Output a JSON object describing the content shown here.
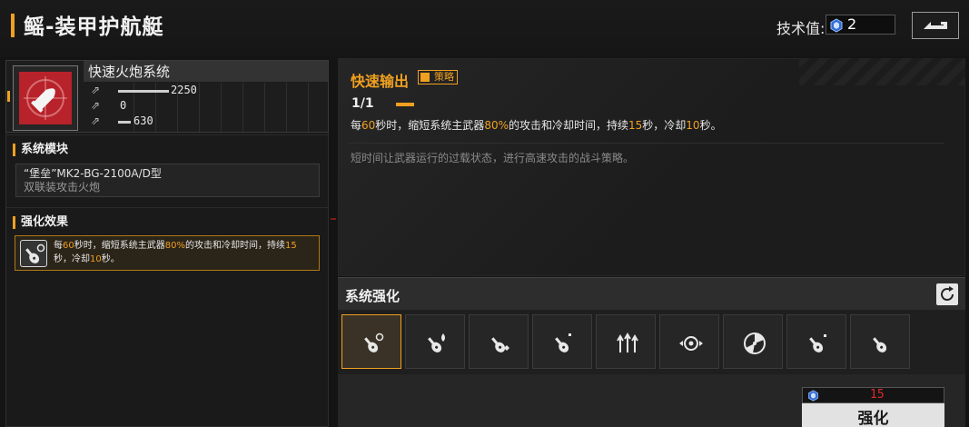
{
  "header": {
    "title": "鳐-装甲护航艇",
    "tech_label": "技术值:",
    "tech_value": "2",
    "back_icon": "return-arrow-icon"
  },
  "module": {
    "name": "快速火炮系统",
    "icon": "cannon-shell-icon",
    "stats": [
      {
        "icon": "arrow-up-icon",
        "value": "2250",
        "fill": 0.78
      },
      {
        "icon": "arrow-up-icon",
        "value": "0",
        "fill": 0.0
      },
      {
        "icon": "arrow-up-icon",
        "value": "630",
        "fill": 0.22
      }
    ]
  },
  "system_module": {
    "label": "系统模块",
    "name": "“堡垒”MK2-BG-2100A/D型",
    "type": "双联装攻击火炮"
  },
  "enhance_effect": {
    "label": "强化效果",
    "parts": [
      "每",
      "60",
      "秒时，缩短系统主武器",
      "80%",
      "的攻击和冷却时间，持续",
      "15",
      "秒，冷却",
      "10",
      "秒。"
    ]
  },
  "skill": {
    "title": "快速输出",
    "tag": "策略",
    "level": "1/1",
    "desc_parts": [
      "每",
      "60",
      "秒时，缩短系统主武器",
      "80%",
      "的攻击和冷却时间，持续",
      "15",
      "秒，冷却",
      "10",
      "秒。"
    ],
    "flavor": "短时间让武器运行的过载状态，进行高速攻击的战斗策略。"
  },
  "system_enhance": {
    "title": "系统强化",
    "refresh_icon": "refresh-icon",
    "slots": [
      {
        "icon": "guitar-gear-icon",
        "active": true
      },
      {
        "icon": "guitar-flame-icon",
        "active": false
      },
      {
        "icon": "guitar-spark-icon",
        "active": false
      },
      {
        "icon": "guitar-icon",
        "active": false
      },
      {
        "icon": "triple-arrow-up-icon",
        "active": false
      },
      {
        "icon": "target-arrows-icon",
        "active": false
      },
      {
        "icon": "radar-icon",
        "active": false
      },
      {
        "icon": "guitar-icon",
        "active": false
      },
      {
        "icon": "guitar-icon",
        "active": false
      }
    ],
    "cost": "15",
    "upgrade_label": "强化"
  },
  "colors": {
    "accent": "#f0a020",
    "module_red": "#b8222a",
    "cost_red": "#e02828"
  }
}
